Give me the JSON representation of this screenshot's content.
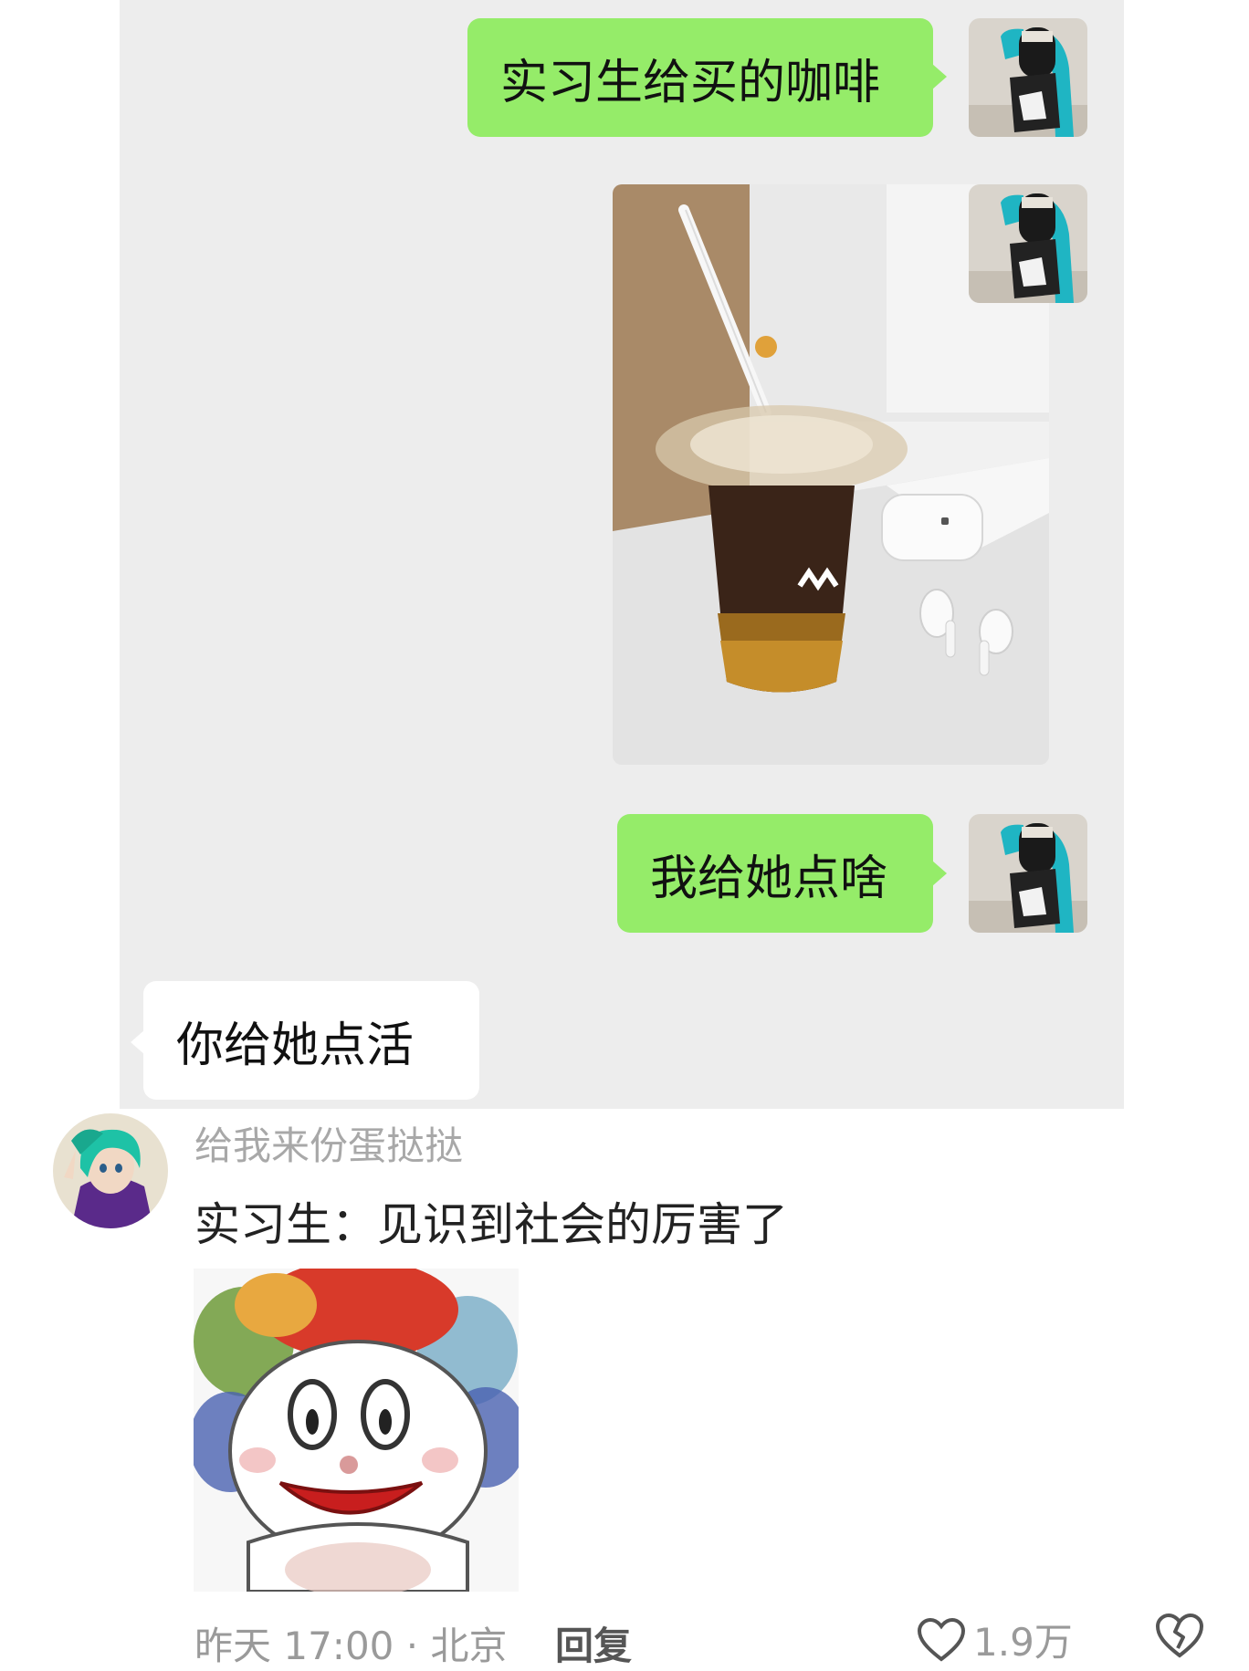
{
  "chat": {
    "messages": [
      {
        "side": "right",
        "type": "text",
        "text": "实习生给买的咖啡"
      },
      {
        "side": "right",
        "type": "image"
      },
      {
        "side": "right",
        "type": "text",
        "text": "我给她点啥"
      },
      {
        "side": "left",
        "type": "text",
        "text": "你给她点活"
      }
    ]
  },
  "comment": {
    "username": "给我来份蛋挞挞",
    "text": "实习生：见识到社会的厉害了",
    "time_location": "昨天 17:00 · 北京",
    "reply_label": "回复",
    "like_count": "1.9万"
  },
  "colors": {
    "self_bubble": "#95ec69",
    "other_bubble": "#ffffff",
    "chat_background": "#ededed"
  }
}
